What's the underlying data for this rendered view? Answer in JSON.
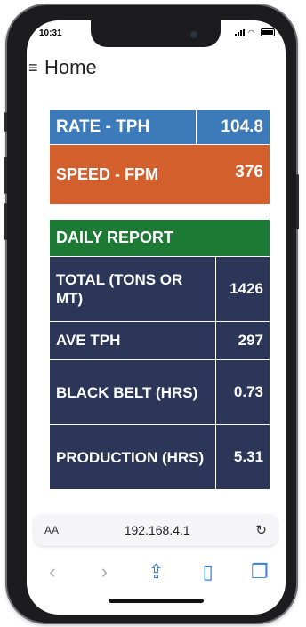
{
  "status": {
    "time": "10:31"
  },
  "header": {
    "title": "Home",
    "menu_icon": "hamburger-menu-icon"
  },
  "metrics": {
    "rate": {
      "label": "RATE - TPH",
      "value": "104.8"
    },
    "speed": {
      "label": "SPEED - FPM",
      "value": "376"
    }
  },
  "daily_report": {
    "title": "DAILY REPORT",
    "rows": [
      {
        "label": "TOTAL (TONS OR MT)",
        "value": "1426"
      },
      {
        "label": "AVE TPH",
        "value": "297"
      },
      {
        "label": "BLACK BELT (HRS)",
        "value": "0.73"
      },
      {
        "label": "PRODUCTION (HRS)",
        "value": "5.31"
      }
    ]
  },
  "browser": {
    "text_size_label": "AA",
    "url": "192.168.4.1",
    "icons": [
      "back-icon",
      "forward-icon",
      "share-icon",
      "bookmarks-icon",
      "tabs-icon"
    ]
  },
  "colors": {
    "rate_bg": "#3d7ab9",
    "speed_bg": "#d25f2c",
    "daily_bg": "#1d7a34",
    "dark_bg": "#2b3658"
  }
}
